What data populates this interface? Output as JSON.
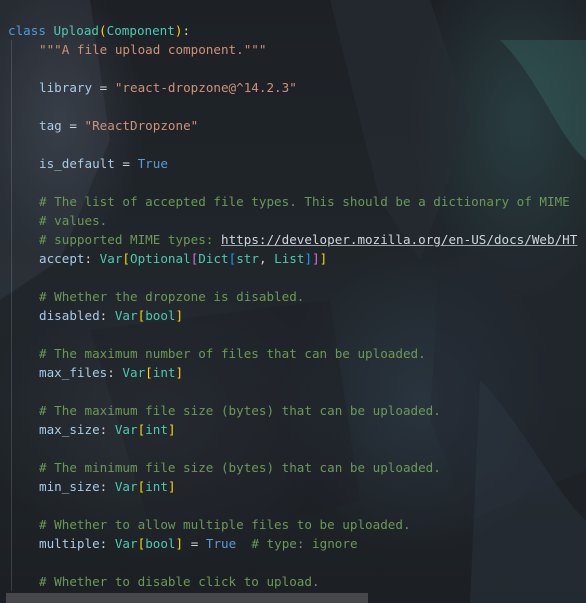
{
  "code": {
    "class_kw": "class",
    "class_name": "Upload",
    "base_class": "Component",
    "docstring": "\"\"\"A file upload component.\"\"\"",
    "library_name": "library",
    "library_value": "\"react-dropzone@^14.2.3\"",
    "tag_name": "tag",
    "tag_value": "\"ReactDropzone\"",
    "is_default_name": "is_default",
    "is_default_value": "True",
    "accept_comment_1": "# The list of accepted file types. This should be a dictionary of MIME",
    "accept_comment_2": "# values.",
    "accept_comment_3_prefix": "# supported MIME types: ",
    "accept_comment_3_url": "https://developer.mozilla.org/en-US/docs/Web/HT",
    "accept_name": "accept",
    "var": "Var",
    "optional": "Optional",
    "dict": "Dict",
    "str_type": "str",
    "list_type": "List",
    "disabled_comment": "# Whether the dropzone is disabled.",
    "disabled_name": "disabled",
    "bool_type": "bool",
    "max_files_comment": "# The maximum number of files that can be uploaded.",
    "max_files_name": "max_files",
    "int_type": "int",
    "max_size_comment": "# The maximum file size (bytes) that can be uploaded.",
    "max_size_name": "max_size",
    "min_size_comment": "# The minimum file size (bytes) that can be uploaded.",
    "min_size_name": "min_size",
    "multiple_comment": "# Whether to allow multiple files to be uploaded.",
    "multiple_name": "multiple",
    "multiple_value": "True",
    "multiple_trailing_comment": "# type: ignore",
    "no_click_comment": "# Whether to disable click to upload."
  },
  "colors": {
    "background": "#1b1f24",
    "keyword": "#4f9bd8",
    "class": "#4ec9b0",
    "string": "#ce9178",
    "comment": "#6a9955"
  }
}
